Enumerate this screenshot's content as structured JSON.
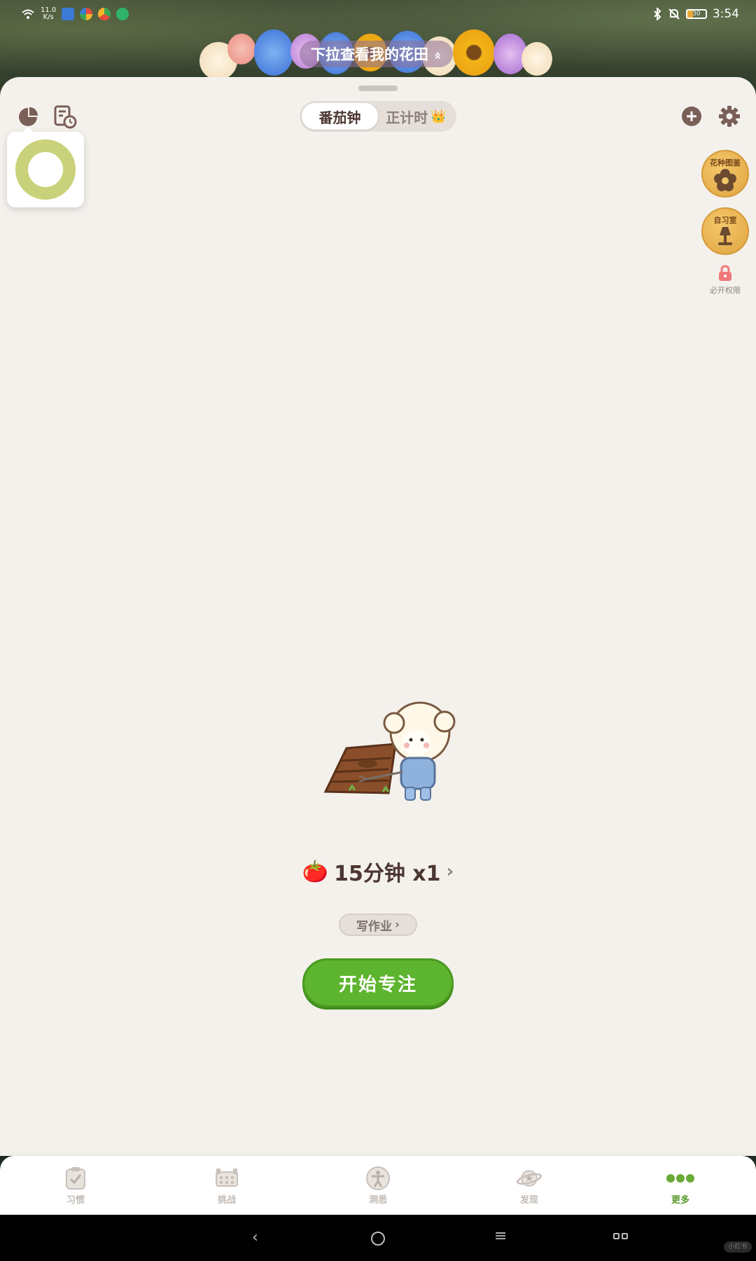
{
  "status_bar": {
    "net_speed_value": "11.0",
    "net_speed_unit": "K/s",
    "time": "3:54",
    "battery": "30"
  },
  "banner": {
    "label": "下拉查看我的花田",
    "chevron": "»"
  },
  "header": {
    "tabs": [
      {
        "label": "番茄钟",
        "active": true
      },
      {
        "label": "正计时",
        "active": false,
        "badge_icon": "crown-icon"
      }
    ],
    "crown": "👑"
  },
  "side_panel": {
    "catalog_label": "花种图鉴",
    "study_room_label": "自习室",
    "permissions_label": "必开权限"
  },
  "session": {
    "emoji": "🍅",
    "text": "15分钟 x1",
    "chevron": "›"
  },
  "task": {
    "label": "写作业",
    "chevron": "›"
  },
  "start_button_label": "开始专注",
  "bottom_nav": {
    "items": [
      {
        "label": "习惯",
        "icon": "checkbox-icon",
        "active": false
      },
      {
        "label": "挑战",
        "icon": "calendar-icon",
        "active": false
      },
      {
        "label": "洞悉",
        "icon": "person-icon",
        "active": false
      },
      {
        "label": "发现",
        "icon": "planet-icon",
        "active": false
      },
      {
        "label": "更多",
        "icon": "more-dots-icon",
        "active": true
      }
    ]
  },
  "system_nav": {
    "back": "‹",
    "menu": "≡",
    "watermark": "小红书"
  },
  "colors": {
    "accent_green": "#5db42e",
    "sheet_bg": "#f4f1ec",
    "brown_text": "#4b3631",
    "donut": "#c9d27a"
  }
}
